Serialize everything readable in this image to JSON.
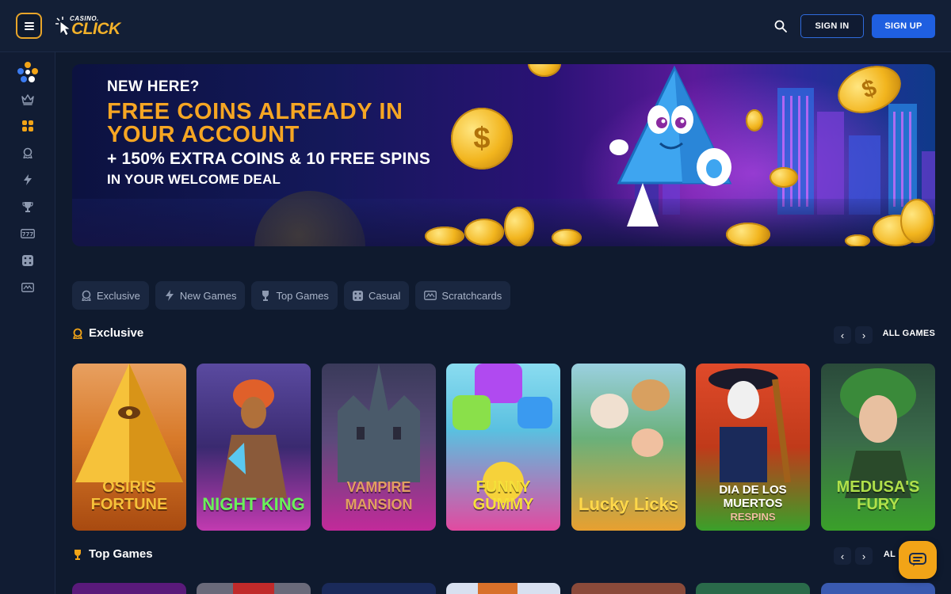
{
  "header": {
    "logo_small": "CASINO.",
    "logo_big": "CLICK",
    "search_icon": "search-icon",
    "signin_label": "SIGN IN",
    "signup_label": "SIGN UP"
  },
  "sidebar": {
    "items": [
      {
        "icon": "people-icon"
      },
      {
        "icon": "crown-icon"
      },
      {
        "icon": "grid-icon"
      },
      {
        "icon": "exclusive-icon"
      },
      {
        "icon": "lightning-icon"
      },
      {
        "icon": "trophy-icon"
      },
      {
        "icon": "slot-777-icon"
      },
      {
        "icon": "dice-icon"
      },
      {
        "icon": "scratchcard-icon"
      }
    ]
  },
  "banner": {
    "line1": "NEW HERE?",
    "line2": "FREE COINS ALREADY IN YOUR ACCOUNT",
    "line3": "+ 150% EXTRA COINS & 10 FREE SPINS",
    "line4": "IN YOUR WELCOME DEAL"
  },
  "categories": [
    {
      "label": "Exclusive",
      "icon": "exclusive-icon"
    },
    {
      "label": "New Games",
      "icon": "lightning-icon"
    },
    {
      "label": "Top Games",
      "icon": "trophy-icon"
    },
    {
      "label": "Casual",
      "icon": "dice-icon"
    },
    {
      "label": "Scratchcards",
      "icon": "scratchcard-icon"
    }
  ],
  "sections": {
    "exclusive": {
      "title": "Exclusive",
      "all_label": "ALL GAMES"
    },
    "top": {
      "title": "Top Games",
      "all_label": "AL"
    }
  },
  "exclusive_games": [
    {
      "name": "OSIRIS FORTUNE",
      "sub": ""
    },
    {
      "name": "NIGHT KING",
      "sub": ""
    },
    {
      "name": "VAMPIRE MANSION",
      "sub": ""
    },
    {
      "name": "FUNNY GUMMY",
      "sub": ""
    },
    {
      "name": "Lucky Licks",
      "sub": ""
    },
    {
      "name": "DIA DE LOS MUERTOS",
      "sub": "RESPINS"
    },
    {
      "name": "MEDUSA'S FURY",
      "sub": ""
    }
  ],
  "colors": {
    "accent": "#f2a417",
    "primary": "#1f5fe0",
    "background": "#0f1a2e"
  }
}
